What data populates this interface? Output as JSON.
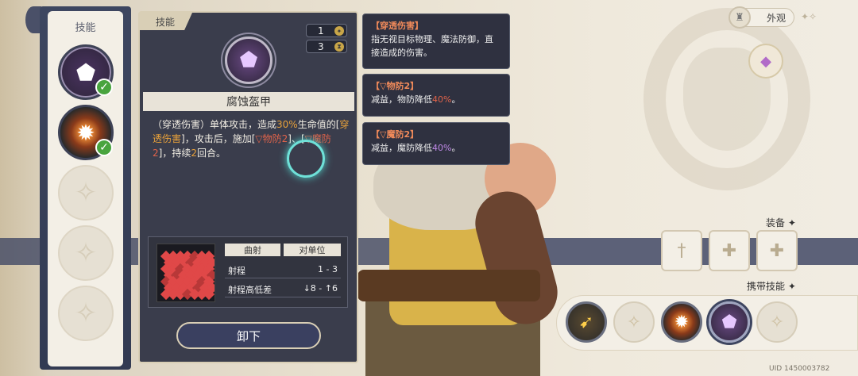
{
  "skill_list": {
    "title": "技能",
    "slots": [
      {
        "state": "equipped",
        "icon": "cracked-armor-icon"
      },
      {
        "state": "equipped",
        "icon": "fire-burst-icon"
      },
      {
        "state": "empty",
        "icon": "staff-sparkle-icon"
      },
      {
        "state": "empty",
        "icon": "staff-sparkle-icon"
      },
      {
        "state": "empty",
        "icon": "staff-sparkle-icon"
      }
    ]
  },
  "detail": {
    "tag": "技能",
    "counter1": "1",
    "counter2": "3",
    "name": "腐蚀盔甲",
    "desc_parts": {
      "p1": "（穿透伤害）单体攻击，造成",
      "pct": "30%",
      "p2": "生命值的[",
      "dmg": "穿透伤害",
      "p3": "]，攻击后，施加[",
      "d1": "▽物防2",
      "p4": "]、[",
      "d2": "▽魔防2",
      "p5": "]，持续",
      "turns": "2",
      "p6": "回合。"
    },
    "range": {
      "head_type": "曲射",
      "head_target": "对单位",
      "rows": [
        {
          "key": "射程",
          "value": "1 - 3"
        },
        {
          "key": "射程高低差",
          "value": "↓8 - ↑6"
        }
      ]
    },
    "unload_label": "卸下"
  },
  "tooltips": [
    {
      "title": "【穿透伤害】",
      "body": "指无视目标物理、魔法防御，直接造成的伤害。"
    },
    {
      "title": "【▽物防2】",
      "body_pre": "减益，物防降低",
      "pct": "40%",
      "body_post": "。"
    },
    {
      "title": "【▽魔防2】",
      "body_pre": "减益，魔防降低",
      "pct": "40%",
      "body_post": "。"
    }
  ],
  "right": {
    "appearance_label": "外观",
    "equip_label": "装备",
    "carry_label": "携带技能",
    "equip_slots": [
      "sword-icon",
      "shield-plus-icon",
      "gem-plus-icon"
    ],
    "carry_slots": [
      "bow-icon",
      "staff-sparkle-icon",
      "fire-burst-icon",
      "cracked-armor-icon",
      "staff-sparkle-icon"
    ]
  },
  "uid": "UID 1450003782"
}
